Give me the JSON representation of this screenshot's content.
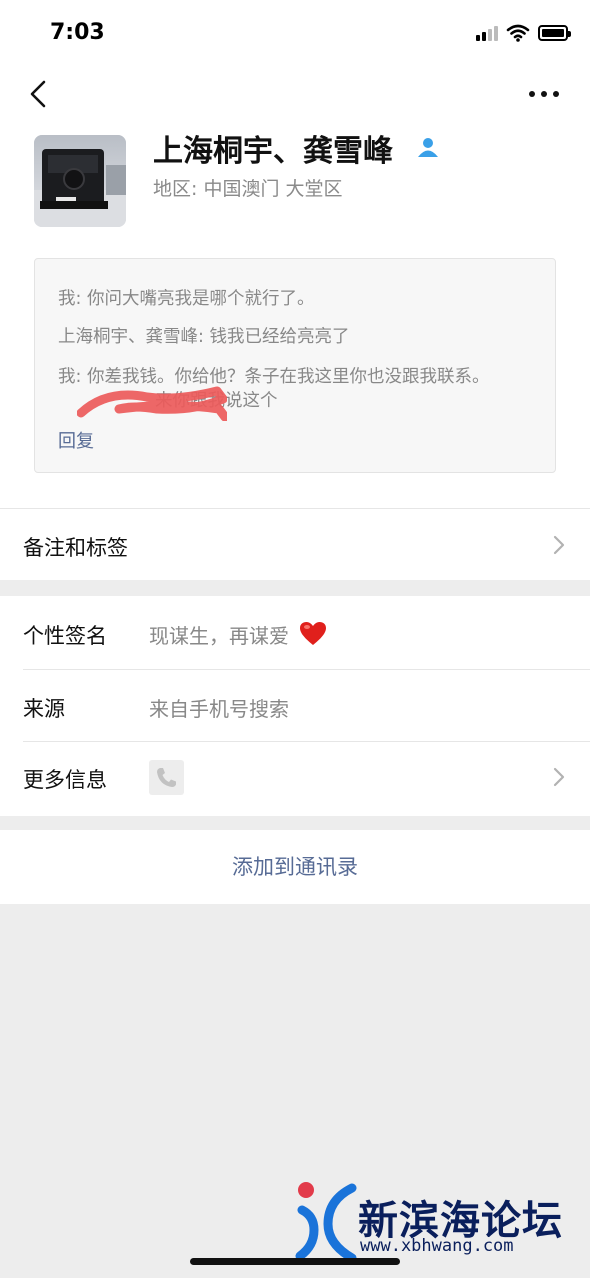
{
  "status_bar": {
    "time": "7:03"
  },
  "profile": {
    "name": "上海桐宇、龚雪峰",
    "region": "地区: 中国澳门 大堂区"
  },
  "messages": [
    {
      "text": "我: 你问大嘴亮我是哪个就行了。"
    },
    {
      "text": "上海桐宇、龚雪峰: 钱我已经给亮亮了"
    },
    {
      "text": "我: 你差我钱。你给他？条子在我这里你也没跟我联系。"
    },
    {
      "text": "来你跟我说这个"
    }
  ],
  "reply_label": "回复",
  "rows": {
    "remarks_label": "备注和标签",
    "signature_label": "个性签名",
    "signature_value": "现谋生，再谋爱",
    "source_label": "来源",
    "source_value": "来自手机号搜索",
    "more_label": "更多信息"
  },
  "add_contact_label": "添加到通讯录",
  "watermark": {
    "title": "新滨海论坛",
    "url": "www.xbhwang.com"
  },
  "colors": {
    "link": "#576b95",
    "background": "#ededed",
    "heart": "#e0201c",
    "contact_icon": "#3aa0e8"
  }
}
